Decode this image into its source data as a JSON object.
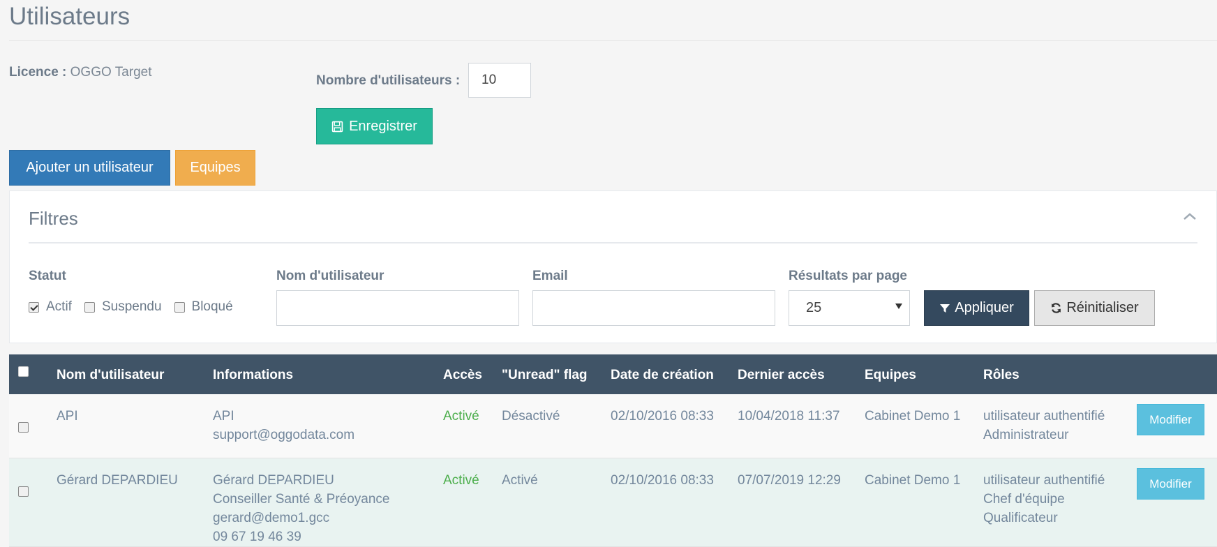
{
  "page": {
    "title": "Utilisateurs"
  },
  "licence": {
    "label": "Licence :",
    "value": "OGGO Target"
  },
  "nb_users": {
    "label": "Nombre d'utilisateurs :",
    "value": "10"
  },
  "buttons": {
    "save": "Enregistrer",
    "add_user": "Ajouter un utilisateur",
    "teams": "Equipes"
  },
  "filters": {
    "title": "Filtres",
    "status_label": "Statut",
    "status_options": [
      {
        "label": "Actif",
        "checked": true
      },
      {
        "label": "Suspendu",
        "checked": false
      },
      {
        "label": "Bloqué",
        "checked": false
      }
    ],
    "username_label": "Nom d'utilisateur",
    "username_value": "",
    "email_label": "Email",
    "email_value": "",
    "per_page_label": "Résultats par page",
    "per_page_value": "25",
    "apply": "Appliquer",
    "reset": "Réinitialiser"
  },
  "table": {
    "headers": [
      "Nom d'utilisateur",
      "Informations",
      "Accès",
      "\"Unread\" flag",
      "Date de création",
      "Dernier accès",
      "Equipes",
      "Rôles"
    ],
    "rows": [
      {
        "name": "API",
        "info": [
          "API",
          "support@oggodata.com"
        ],
        "access": "Activé",
        "unread": "Désactivé",
        "created": "02/10/2016 08:33",
        "last_access": "10/04/2018 11:37",
        "teams": "Cabinet Demo 1",
        "roles": [
          "utilisateur authentifié",
          "Administrateur"
        ],
        "action": "Modifier"
      },
      {
        "name": "Gérard DEPARDIEU",
        "info": [
          "Gérard DEPARDIEU",
          "Conseiller Santé & Préoyance",
          "gerard@demo1.gcc",
          "09 67 19 46 39"
        ],
        "access": "Activé",
        "unread": "Activé",
        "created": "02/10/2016 08:33",
        "last_access": "07/07/2019 12:29",
        "teams": "Cabinet Demo 1",
        "roles": [
          "utilisateur authentifié",
          "Chef d'équipe",
          "Qualificateur"
        ],
        "action": "Modifier"
      }
    ]
  },
  "colors": {
    "save": "#26b99a",
    "add_user": "#337ab7",
    "teams": "#f0ad4e",
    "table_header": "#405467",
    "apply": "#34495e",
    "modify": "#5bc0de",
    "access_active": "#4cae4c"
  },
  "icons": {
    "save": "floppy-disk-icon",
    "apply": "filter-icon",
    "reset": "refresh-icon",
    "collapse": "chevron-up-icon"
  }
}
